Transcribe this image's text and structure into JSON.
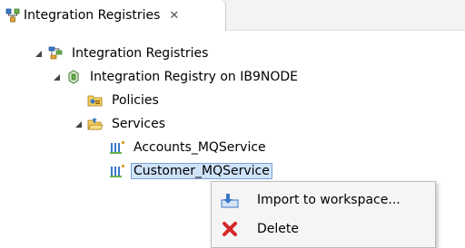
{
  "tab": {
    "title": "Integration Registries",
    "close_glyph": "✕"
  },
  "tree": {
    "root": "Integration Registries",
    "registry": "Integration Registry on IB9NODE",
    "policies": "Policies",
    "services": "Services",
    "service_items": [
      "Accounts_MQService",
      "Customer_MQService"
    ],
    "selected": "Customer_MQService"
  },
  "context_menu": {
    "items": [
      {
        "label": "Import to workspace...",
        "icon": "import-icon"
      },
      {
        "label": "Delete",
        "icon": "delete-icon"
      }
    ]
  },
  "colors": {
    "selection": "#cfe3fb",
    "selection_border": "#7da2ce",
    "delete": "#d62828"
  }
}
